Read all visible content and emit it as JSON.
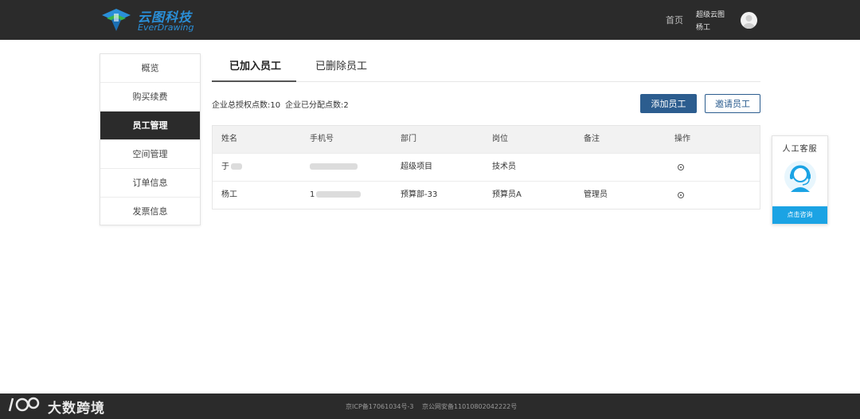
{
  "header": {
    "logo_cn": "云图科技",
    "logo_en": "EverDrawing",
    "nav_home": "首页",
    "user_company": "超级云图",
    "user_name": "杨工"
  },
  "sidebar": {
    "items": [
      {
        "label": "概览",
        "active": false
      },
      {
        "label": "购买续费",
        "active": false
      },
      {
        "label": "员工管理",
        "active": true
      },
      {
        "label": "空间管理",
        "active": false
      },
      {
        "label": "订单信息",
        "active": false
      },
      {
        "label": "发票信息",
        "active": false
      }
    ]
  },
  "tabs": [
    {
      "label": "已加入员工",
      "active": true
    },
    {
      "label": "已删除员工",
      "active": false
    }
  ],
  "stats": {
    "licensed": "企业总授权点数:10",
    "assigned": "企业已分配点数:2"
  },
  "buttons": {
    "add": "添加员工",
    "invite": "邀请员工"
  },
  "table": {
    "headers": [
      "姓名",
      "手机号",
      "部门",
      "岗位",
      "备注",
      "操作"
    ],
    "rows": [
      {
        "name": "于",
        "phone": "",
        "dept": "超级项目",
        "position": "技术员",
        "note": ""
      },
      {
        "name": "杨工",
        "phone": "1",
        "dept": "预算部-33",
        "position": "预算员A",
        "note": "管理员"
      }
    ]
  },
  "customer_service": {
    "title": "人工客服",
    "button": "点击咨询",
    "accent": "#1ba3e4"
  },
  "footer": {
    "icp": "京ICP备17061034号-3",
    "gongan": "京公网安备11010802042222号"
  },
  "watermark": {
    "text": "大数跨境"
  },
  "colors": {
    "header_bg": "#2b2b2b",
    "primary_button": "#2c5d8f",
    "logo_blue": "#2a8fd8"
  }
}
